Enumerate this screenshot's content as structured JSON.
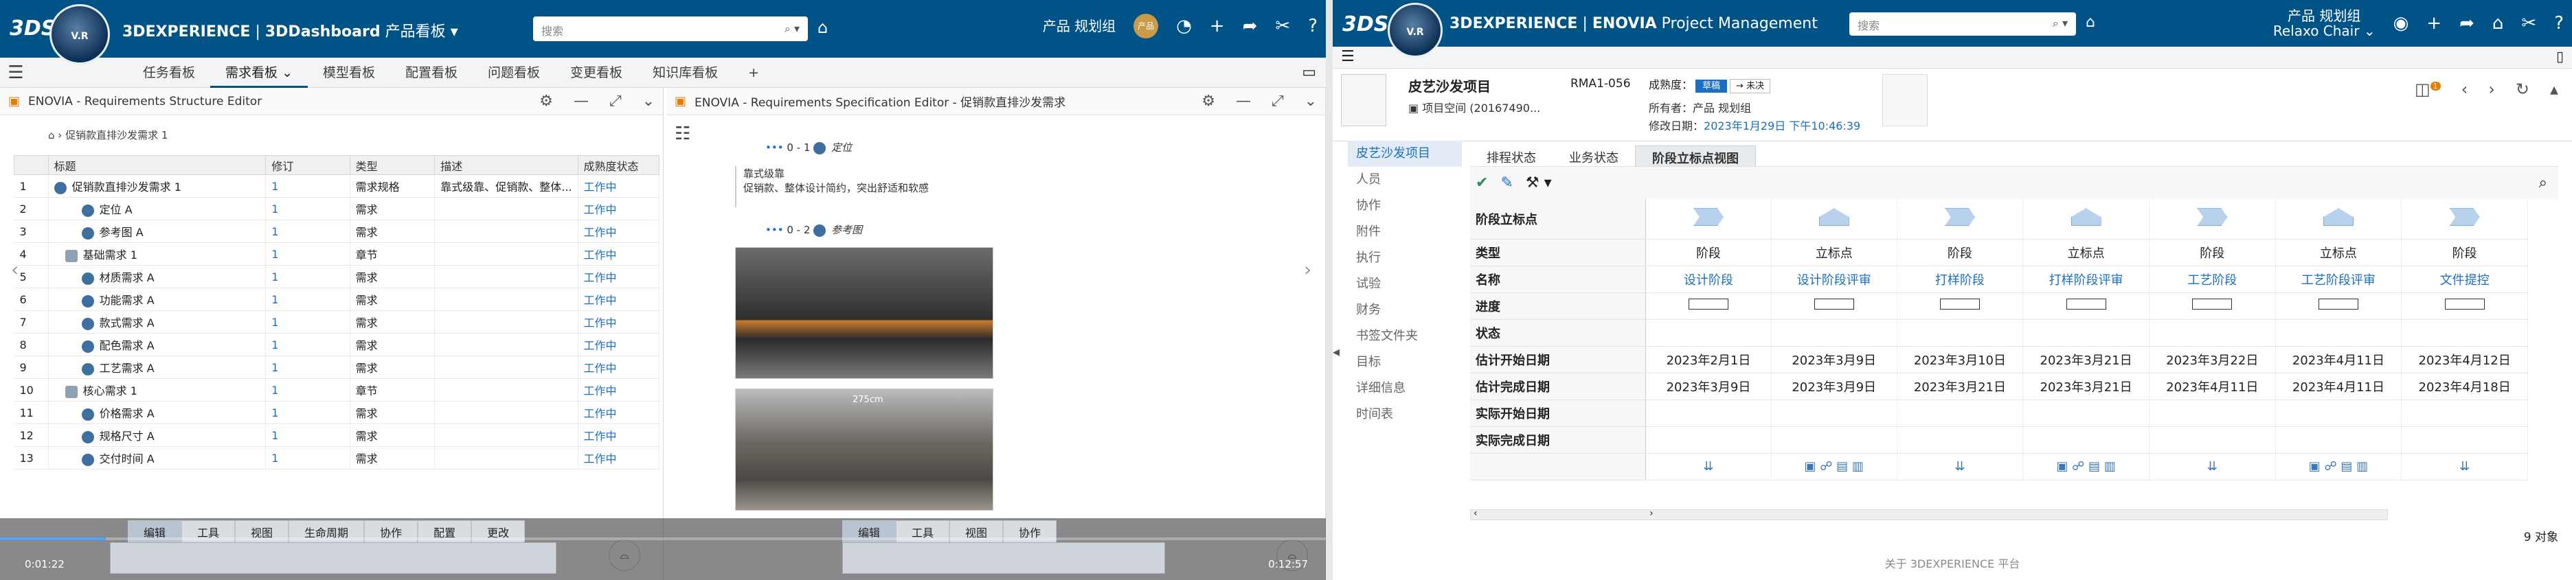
{
  "left": {
    "app": {
      "brand_prefix": "3DEXPERIENCE",
      "brand_app": "3DDashboard",
      "brand_suffix": "产品看板",
      "compass_label": "V.R"
    },
    "search": {
      "placeholder": "搜索"
    },
    "user": {
      "name": "产品 规划组",
      "avatar": "产品"
    },
    "tabs": [
      "任务看板",
      "需求看板",
      "模型看板",
      "配置看板",
      "问题看板",
      "变更看板",
      "知识库看板"
    ],
    "active_tab": "需求看板",
    "structure": {
      "title": "ENOVIA - Requirements Structure Editor",
      "breadcrumb": "促销款直排沙发需求 1",
      "columns": [
        "标题",
        "修订",
        "类型",
        "描述",
        "成熟度状态"
      ],
      "rows": [
        {
          "n": "1",
          "title": "促销款直排沙发需求 1",
          "rev": "1",
          "type": "需求规格",
          "desc": "靠式级靠、促销款、整体...",
          "state": "工作中"
        },
        {
          "n": "2",
          "title": "定位 A",
          "rev": "1",
          "type": "需求",
          "desc": "",
          "state": "工作中"
        },
        {
          "n": "3",
          "title": "参考图 A",
          "rev": "1",
          "type": "需求",
          "desc": "",
          "state": "工作中"
        },
        {
          "n": "4",
          "title": "基础需求 1",
          "rev": "1",
          "type": "章节",
          "desc": "",
          "state": "工作中"
        },
        {
          "n": "5",
          "title": "材质需求 A",
          "rev": "1",
          "type": "需求",
          "desc": "",
          "state": "工作中"
        },
        {
          "n": "6",
          "title": "功能需求 A",
          "rev": "1",
          "type": "需求",
          "desc": "",
          "state": "工作中"
        },
        {
          "n": "7",
          "title": "款式需求 A",
          "rev": "1",
          "type": "需求",
          "desc": "",
          "state": "工作中"
        },
        {
          "n": "8",
          "title": "配色需求 A",
          "rev": "1",
          "type": "需求",
          "desc": "",
          "state": "工作中"
        },
        {
          "n": "9",
          "title": "工艺需求 A",
          "rev": "1",
          "type": "需求",
          "desc": "",
          "state": "工作中"
        },
        {
          "n": "10",
          "title": "核心需求 1",
          "rev": "1",
          "type": "章节",
          "desc": "",
          "state": "工作中"
        },
        {
          "n": "11",
          "title": "价格需求 A",
          "rev": "1",
          "type": "需求",
          "desc": "",
          "state": "工作中"
        },
        {
          "n": "12",
          "title": "规格尺寸 A",
          "rev": "1",
          "type": "需求",
          "desc": "",
          "state": "工作中"
        },
        {
          "n": "13",
          "title": "交付时间 A",
          "rev": "1",
          "type": "需求",
          "desc": "",
          "state": "工作中"
        }
      ]
    },
    "spec": {
      "title": "ENOVIA - Requirements Specification Editor - 促销款直排沙发需求",
      "item1_label": "0 - 1",
      "item1_name": "定位",
      "item1_text1": "靠式级靠",
      "item1_text2": "促销款、整体设计简约，突出舒适和软感",
      "item2_label": "0 - 2",
      "item2_name": "参考图",
      "dim_label": "275cm"
    },
    "cmd_left": [
      "编辑",
      "工具",
      "视图",
      "生命周期",
      "协作",
      "配置",
      "更改"
    ],
    "cmd_right": [
      "编辑",
      "工具",
      "视图",
      "协作"
    ],
    "time_start": "0:01:22",
    "time_end": "0:12:57"
  },
  "right": {
    "app": {
      "brand_prefix": "3DEXPERIENCE",
      "brand_app": "ENOVIA",
      "brand_suffix": "Project Management",
      "compass_label": "V.R"
    },
    "search": {
      "placeholder": "搜索"
    },
    "user": {
      "name": "产品 规划组",
      "sub": "Relaxo Chair"
    },
    "object": {
      "name": "皮艺沙发项目",
      "space": "项目空间 (20167490...",
      "code": "RMA1-056",
      "maturity_label": "成熟度：",
      "maturity": "草稿",
      "maturity_next": "→ 未决",
      "owner": "所有者：产品 规划组",
      "modified_label": "修改日期：",
      "modified": "2023年1月29日 下午10:46:39",
      "badge": "1"
    },
    "sidenav": [
      "皮艺沙发项目",
      "人员",
      "协作",
      "附件",
      "执行",
      "试验",
      "财务",
      "书签文件夹",
      "目标",
      "详细信息",
      "时间表"
    ],
    "subtabs": [
      "排程状态",
      "业务状态",
      "阶段立标点视图"
    ],
    "active_subtab": "阶段立标点视图",
    "grid": {
      "header_label": "阶段立标点",
      "row_labels": [
        "类型",
        "名称",
        "进度",
        "状态",
        "估计开始日期",
        "估计完成日期",
        "实际开始日期",
        "实际完成日期"
      ],
      "columns": [
        {
          "type": "阶段",
          "name": "设计阶段",
          "start": "2023年2月1日",
          "end": "2023年3月9日"
        },
        {
          "type": "立标点",
          "name": "设计阶段评审",
          "start": "2023年3月9日",
          "end": "2023年3月9日"
        },
        {
          "type": "阶段",
          "name": "打样阶段",
          "start": "2023年3月10日",
          "end": "2023年3月21日"
        },
        {
          "type": "立标点",
          "name": "打样阶段评审",
          "start": "2023年3月21日",
          "end": "2023年3月21日"
        },
        {
          "type": "阶段",
          "name": "工艺阶段",
          "start": "2023年3月22日",
          "end": "2023年4月11日"
        },
        {
          "type": "立标点",
          "name": "工艺阶段评审",
          "start": "2023年4月11日",
          "end": "2023年4月11日"
        },
        {
          "type": "阶段",
          "name": "文件提控",
          "start": "2023年4月12日",
          "end": "2023年4月18日"
        }
      ],
      "count": "9 对象"
    },
    "footer": "关于 3DEXPERIENCE 平台"
  }
}
